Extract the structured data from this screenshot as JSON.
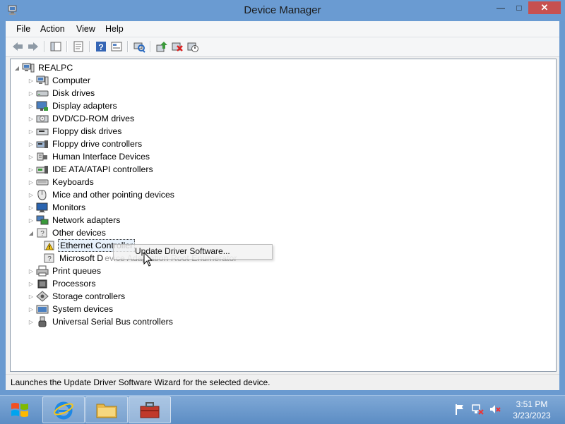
{
  "window": {
    "title": "Device Manager",
    "buttons": {
      "minimize": "—",
      "maximize": "□",
      "close": "✕"
    }
  },
  "menu": [
    "File",
    "Action",
    "View",
    "Help"
  ],
  "toolbar": [
    "back-icon",
    "forward-icon",
    "console-tree-icon",
    "properties-icon",
    "help-icon",
    "view-icon",
    "scan-hardware-icon",
    "update-driver-icon",
    "uninstall-icon",
    "disable-icon"
  ],
  "tree": {
    "root": "REALPC",
    "categories": [
      {
        "label": "Computer",
        "icon": "computer-icon"
      },
      {
        "label": "Disk drives",
        "icon": "disk-drive-icon"
      },
      {
        "label": "Display adapters",
        "icon": "display-adapter-icon"
      },
      {
        "label": "DVD/CD-ROM drives",
        "icon": "dvd-drive-icon"
      },
      {
        "label": "Floppy disk drives",
        "icon": "floppy-disk-icon"
      },
      {
        "label": "Floppy drive controllers",
        "icon": "floppy-controller-icon"
      },
      {
        "label": "Human Interface Devices",
        "icon": "hid-icon"
      },
      {
        "label": "IDE ATA/ATAPI controllers",
        "icon": "ide-controller-icon"
      },
      {
        "label": "Keyboards",
        "icon": "keyboard-icon"
      },
      {
        "label": "Mice and other pointing devices",
        "icon": "mouse-icon"
      },
      {
        "label": "Monitors",
        "icon": "monitor-icon"
      },
      {
        "label": "Network adapters",
        "icon": "network-adapter-icon"
      },
      {
        "label": "Other devices",
        "icon": "unknown-device-icon",
        "expanded": true
      }
    ],
    "other_devices": [
      {
        "label": "Ethernet Controller",
        "icon": "warning-device-icon",
        "selected": true
      },
      {
        "label": "Microsoft D",
        "icon": "unknown-device-icon"
      }
    ],
    "categories_after": [
      {
        "label": "Print queues",
        "icon": "printer-icon"
      },
      {
        "label": "Processors",
        "icon": "processor-icon"
      },
      {
        "label": "Storage controllers",
        "icon": "storage-controller-icon"
      },
      {
        "label": "System devices",
        "icon": "system-device-icon"
      },
      {
        "label": "Universal Serial Bus controllers",
        "icon": "usb-icon"
      }
    ]
  },
  "context_menu": {
    "item": "Update Driver Software...",
    "ghost_text": "evice Adaptation Root Enumerator"
  },
  "status_bar": "Launches the Update Driver Software Wizard for the selected device.",
  "taskbar": {
    "time": "3:51 PM",
    "date": "3/23/2023",
    "apps": [
      "internet-explorer-icon",
      "file-explorer-icon",
      "toolbox-icon"
    ]
  }
}
